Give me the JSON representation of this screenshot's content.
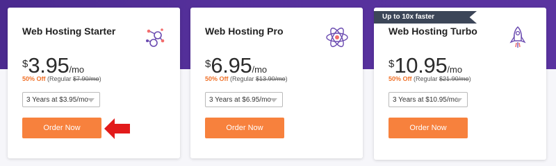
{
  "plans": [
    {
      "name": "Web Hosting Starter",
      "icon": "network-icon",
      "currency": "$",
      "price": "3.95",
      "per": "/mo",
      "discount": "50% Off",
      "regular_prefix": "(Regular ",
      "regular_price": "$7.90/mo",
      "regular_suffix": ")",
      "term_selected": "3 Years at $3.95/mo",
      "button": "Order Now"
    },
    {
      "name": "Web Hosting Pro",
      "icon": "atom-icon",
      "currency": "$",
      "price": "6.95",
      "per": "/mo",
      "discount": "50% Off",
      "regular_prefix": "(Regular ",
      "regular_price": "$13.90/mo",
      "regular_suffix": ")",
      "term_selected": "3 Years at $6.95/mo",
      "button": "Order Now"
    },
    {
      "name": "Web Hosting Turbo",
      "icon": "rocket-icon",
      "ribbon": "Up to 10x faster",
      "currency": "$",
      "price": "10.95",
      "per": "/mo",
      "discount": "50% Off",
      "regular_prefix": "(Regular ",
      "regular_price": "$21.90/mo",
      "regular_suffix": ")",
      "term_selected": "3 Years at $10.95/mo",
      "button": "Order Now"
    }
  ],
  "colors": {
    "accent_orange": "#f7813d",
    "header_purple": "#55309b",
    "ribbon_dark": "#3c4658",
    "pointer_red": "#e21b1b"
  }
}
